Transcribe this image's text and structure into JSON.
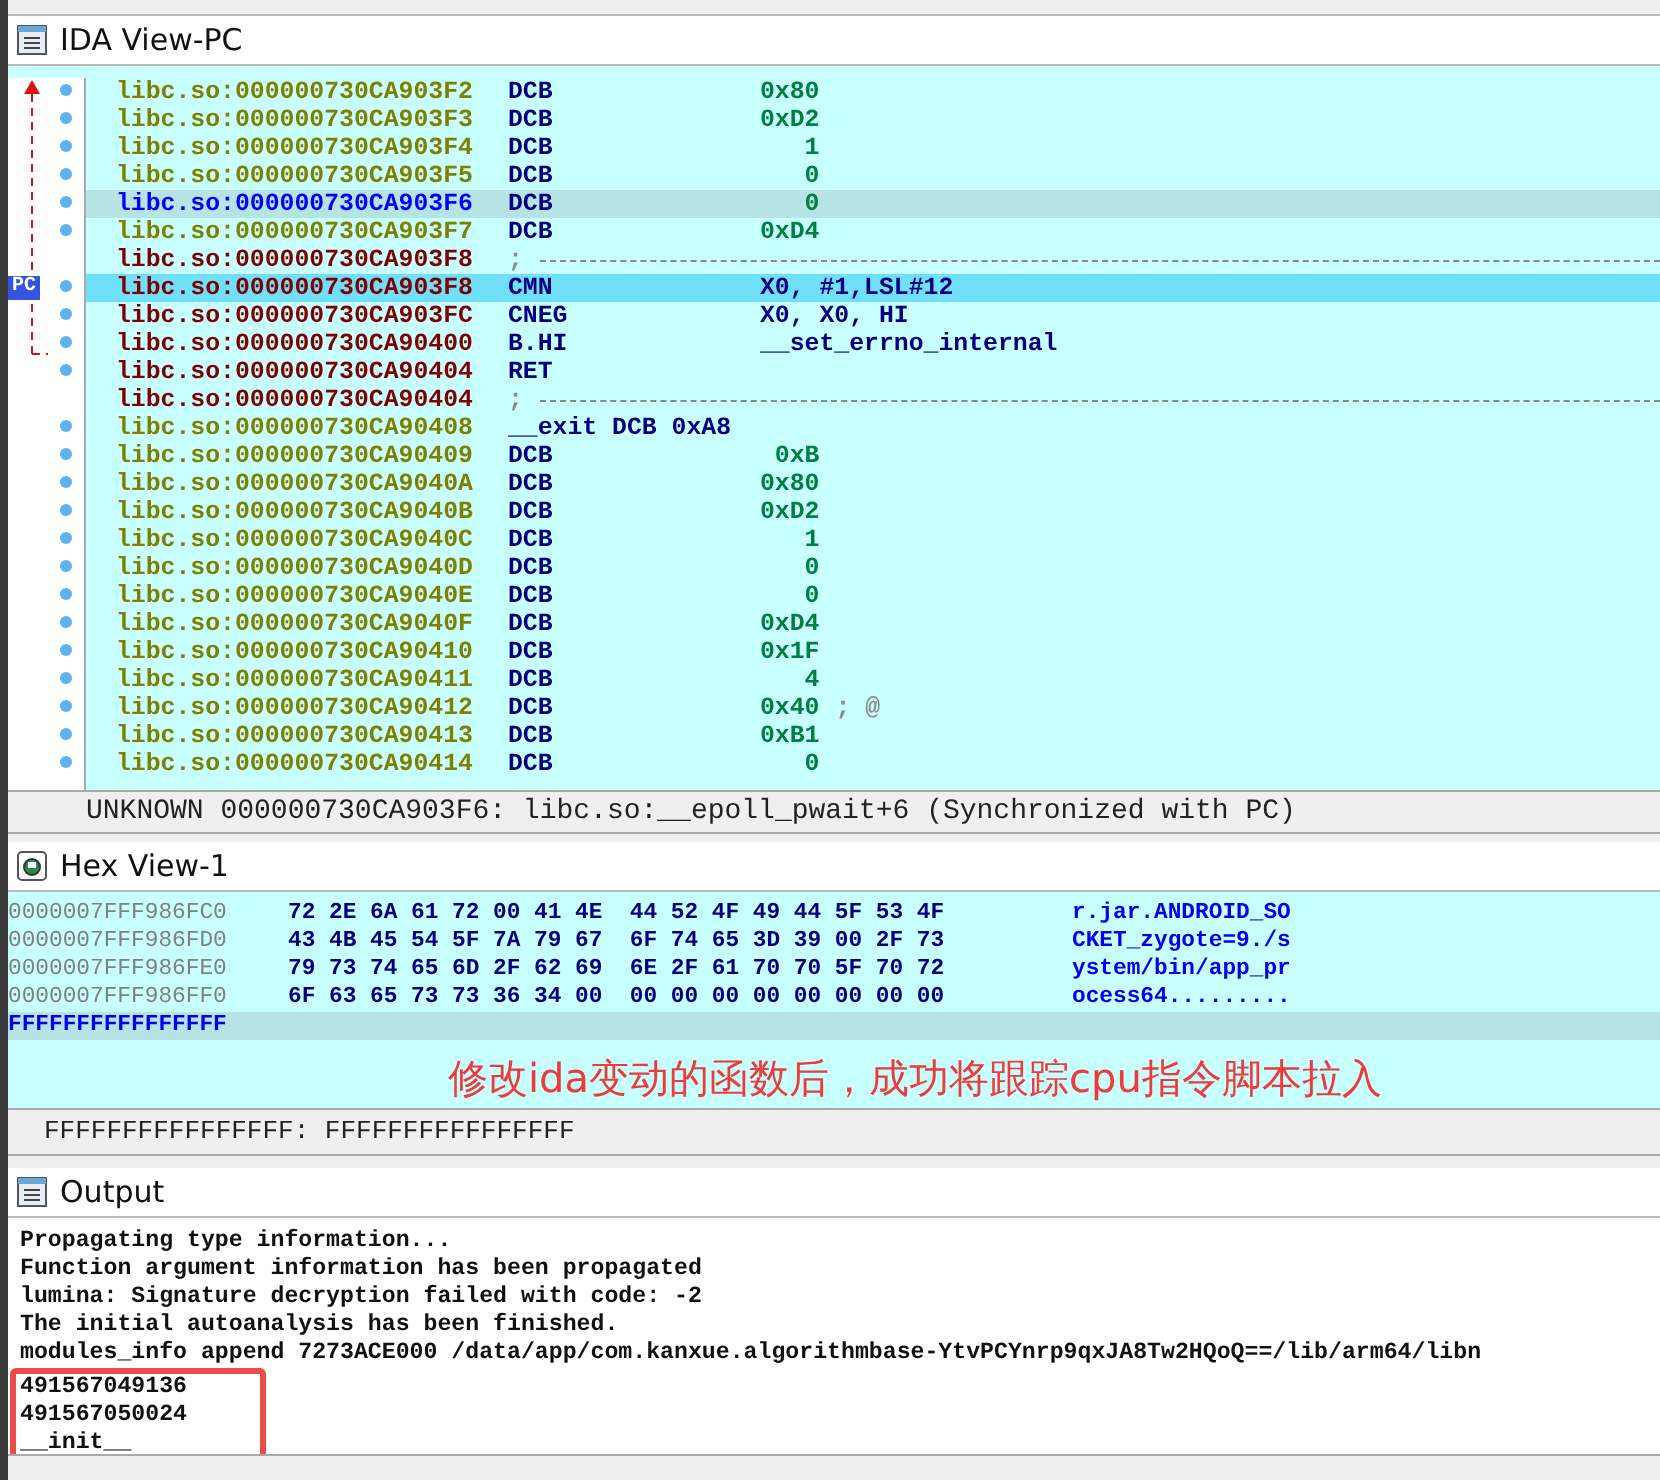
{
  "ida_view": {
    "title": "IDA View-PC",
    "pc_label": "PC",
    "lines": [
      {
        "kind": "data",
        "address": "libc.so:000000730CA903F2",
        "mnemonic": "DCB",
        "operand": "0x80",
        "cursor": false,
        "pc": false
      },
      {
        "kind": "data",
        "address": "libc.so:000000730CA903F3",
        "mnemonic": "DCB",
        "operand": "0xD2",
        "cursor": false,
        "pc": false
      },
      {
        "kind": "data",
        "address": "libc.so:000000730CA903F4",
        "mnemonic": "DCB",
        "operand": "   1",
        "cursor": false,
        "pc": false
      },
      {
        "kind": "data",
        "address": "libc.so:000000730CA903F5",
        "mnemonic": "DCB",
        "operand": "   0",
        "cursor": false,
        "pc": false
      },
      {
        "kind": "data",
        "address": "libc.so:000000730CA903F6",
        "mnemonic": "DCB",
        "operand": "   0",
        "cursor": true,
        "pc": false
      },
      {
        "kind": "data",
        "address": "libc.so:000000730CA903F7",
        "mnemonic": "DCB",
        "operand": "0xD4",
        "cursor": false,
        "pc": false
      },
      {
        "kind": "separator",
        "address": "libc.so:000000730CA903F8",
        "mnemonic": ";",
        "cursor": false,
        "pc": false
      },
      {
        "kind": "code",
        "address": "libc.so:000000730CA903F8",
        "mnemonic": "CMN",
        "operand": "X0, #1,LSL#12",
        "cursor": false,
        "pc": true
      },
      {
        "kind": "code",
        "address": "libc.so:000000730CA903FC",
        "mnemonic": "CNEG",
        "operand": "X0, X0, HI",
        "cursor": false,
        "pc": false
      },
      {
        "kind": "code",
        "address": "libc.so:000000730CA90400",
        "mnemonic": "B.HI",
        "operand": "__set_errno_internal",
        "cursor": false,
        "pc": false
      },
      {
        "kind": "code",
        "address": "libc.so:000000730CA90404",
        "mnemonic": "RET",
        "cursor": false,
        "pc": false
      },
      {
        "kind": "separator",
        "address": "libc.so:000000730CA90404",
        "mnemonic": ";",
        "cursor": false,
        "pc": false
      },
      {
        "kind": "data",
        "address": "libc.so:000000730CA90408",
        "mnemonic": "__exit DCB 0xA8",
        "cursor": false,
        "pc": false
      },
      {
        "kind": "data",
        "address": "libc.so:000000730CA90409",
        "mnemonic": "DCB",
        "operand": " 0xB",
        "cursor": false,
        "pc": false
      },
      {
        "kind": "data",
        "address": "libc.so:000000730CA9040A",
        "mnemonic": "DCB",
        "operand": "0x80",
        "cursor": false,
        "pc": false
      },
      {
        "kind": "data",
        "address": "libc.so:000000730CA9040B",
        "mnemonic": "DCB",
        "operand": "0xD2",
        "cursor": false,
        "pc": false
      },
      {
        "kind": "data",
        "address": "libc.so:000000730CA9040C",
        "mnemonic": "DCB",
        "operand": "   1",
        "cursor": false,
        "pc": false
      },
      {
        "kind": "data",
        "address": "libc.so:000000730CA9040D",
        "mnemonic": "DCB",
        "operand": "   0",
        "cursor": false,
        "pc": false
      },
      {
        "kind": "data",
        "address": "libc.so:000000730CA9040E",
        "mnemonic": "DCB",
        "operand": "   0",
        "cursor": false,
        "pc": false
      },
      {
        "kind": "data",
        "address": "libc.so:000000730CA9040F",
        "mnemonic": "DCB",
        "operand": "0xD4",
        "cursor": false,
        "pc": false
      },
      {
        "kind": "data",
        "address": "libc.so:000000730CA90410",
        "mnemonic": "DCB",
        "operand": "0x1F",
        "cursor": false,
        "pc": false
      },
      {
        "kind": "data",
        "address": "libc.so:000000730CA90411",
        "mnemonic": "DCB",
        "operand": "   4",
        "cursor": false,
        "pc": false
      },
      {
        "kind": "data",
        "address": "libc.so:000000730CA90412",
        "mnemonic": "DCB",
        "operand": "0x40",
        "comment": "; @",
        "cursor": false,
        "pc": false
      },
      {
        "kind": "data",
        "address": "libc.so:000000730CA90413",
        "mnemonic": "DCB",
        "operand": "0xB1",
        "cursor": false,
        "pc": false
      },
      {
        "kind": "data",
        "address": "libc.so:000000730CA90414",
        "mnemonic": "DCB",
        "operand": "   0",
        "cursor": false,
        "pc": false
      }
    ],
    "status": "UNKNOWN 000000730CA903F6: libc.so:__epoll_pwait+6 (Synchronized with PC)"
  },
  "hex_view": {
    "title": "Hex View-1",
    "rows": [
      {
        "address": "0000007FFF986FC0",
        "bytes": "72 2E 6A 61 72 00 41 4E  44 52 4F 49 44 5F 53 4F",
        "ascii": "r.jar.ANDROID_SO"
      },
      {
        "address": "0000007FFF986FD0",
        "bytes": "43 4B 45 54 5F 7A 79 67  6F 74 65 3D 39 00 2F 73",
        "ascii": "CKET_zygote=9./s"
      },
      {
        "address": "0000007FFF986FE0",
        "bytes": "79 73 74 65 6D 2F 62 69  6E 2F 61 70 70 5F 70 72",
        "ascii": "ystem/bin/app_pr"
      },
      {
        "address": "0000007FFF986FF0",
        "bytes": "6F 63 65 73 73 36 34 00  00 00 00 00 00 00 00 00",
        "ascii": "ocess64........."
      }
    ],
    "cursor_address": "FFFFFFFFFFFFFFFF",
    "annotation": "修改ida变动的函数后，成功将跟踪cpu指令脚本拉入",
    "status": "FFFFFFFFFFFFFFFF: FFFFFFFFFFFFFFFF"
  },
  "output": {
    "title": "Output",
    "lines": [
      "Propagating type information...",
      "Function argument information has been propagated",
      "lumina: Signature decryption failed with code: -2",
      "The initial autoanalysis has been finished.",
      "modules_info append 7273ACE000 /data/app/com.kanxue.algorithmbase-YtvPCYnrp9qxJA8Tw2HQoQ==/lib/arm64/libn"
    ],
    "highlighted_lines": [
      "491567049136",
      "491567050024",
      "__init__"
    ]
  }
}
